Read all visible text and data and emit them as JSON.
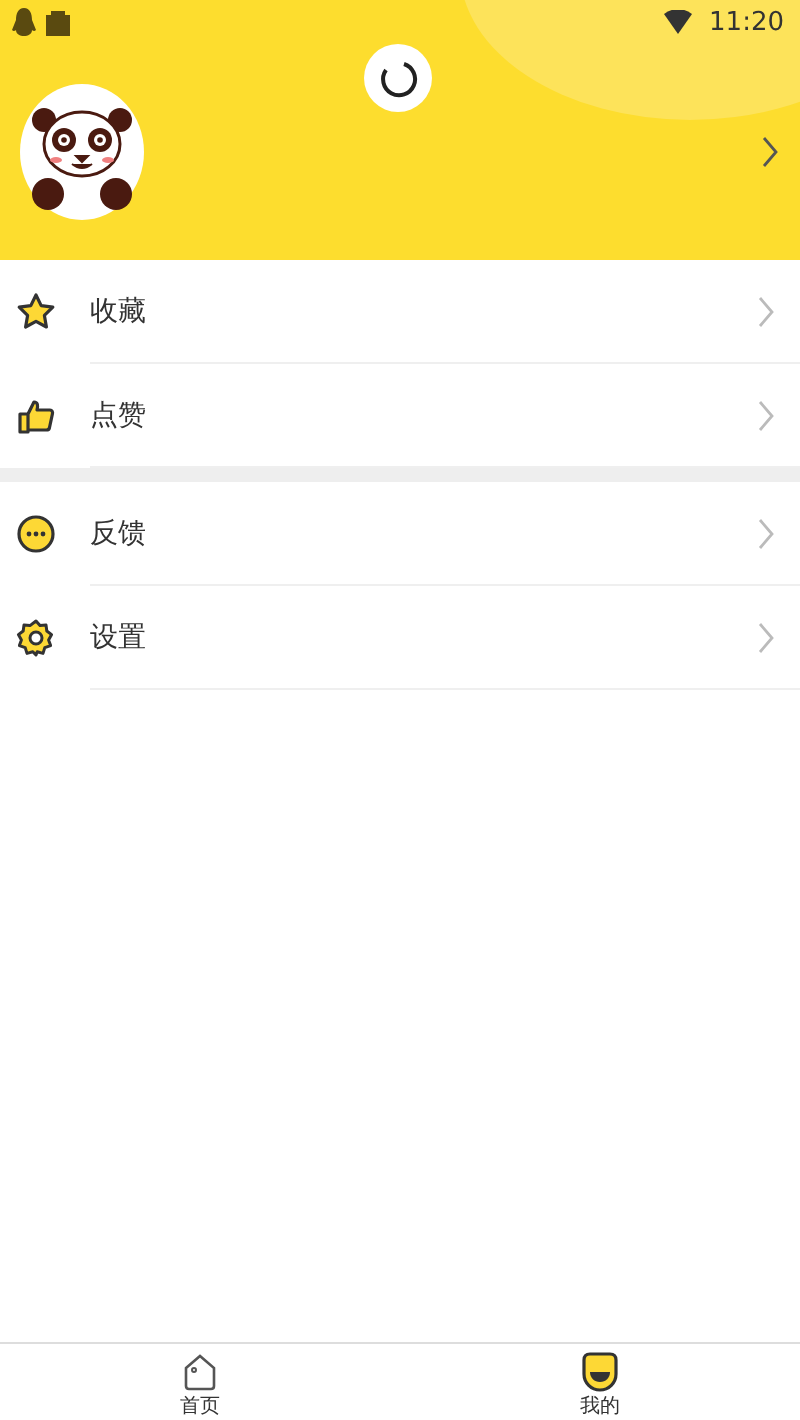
{
  "status_bar": {
    "time": "11:20"
  },
  "menu_groups": [
    {
      "items": [
        {
          "kind": "star",
          "label": "收藏"
        },
        {
          "kind": "thumb",
          "label": "点赞"
        }
      ]
    },
    {
      "items": [
        {
          "kind": "dots",
          "label": "反馈"
        },
        {
          "kind": "gear",
          "label": "设置"
        }
      ]
    }
  ],
  "tabs": [
    {
      "kind": "home",
      "label": "首页",
      "selected": false
    },
    {
      "kind": "face",
      "label": "我的",
      "selected": true
    }
  ]
}
